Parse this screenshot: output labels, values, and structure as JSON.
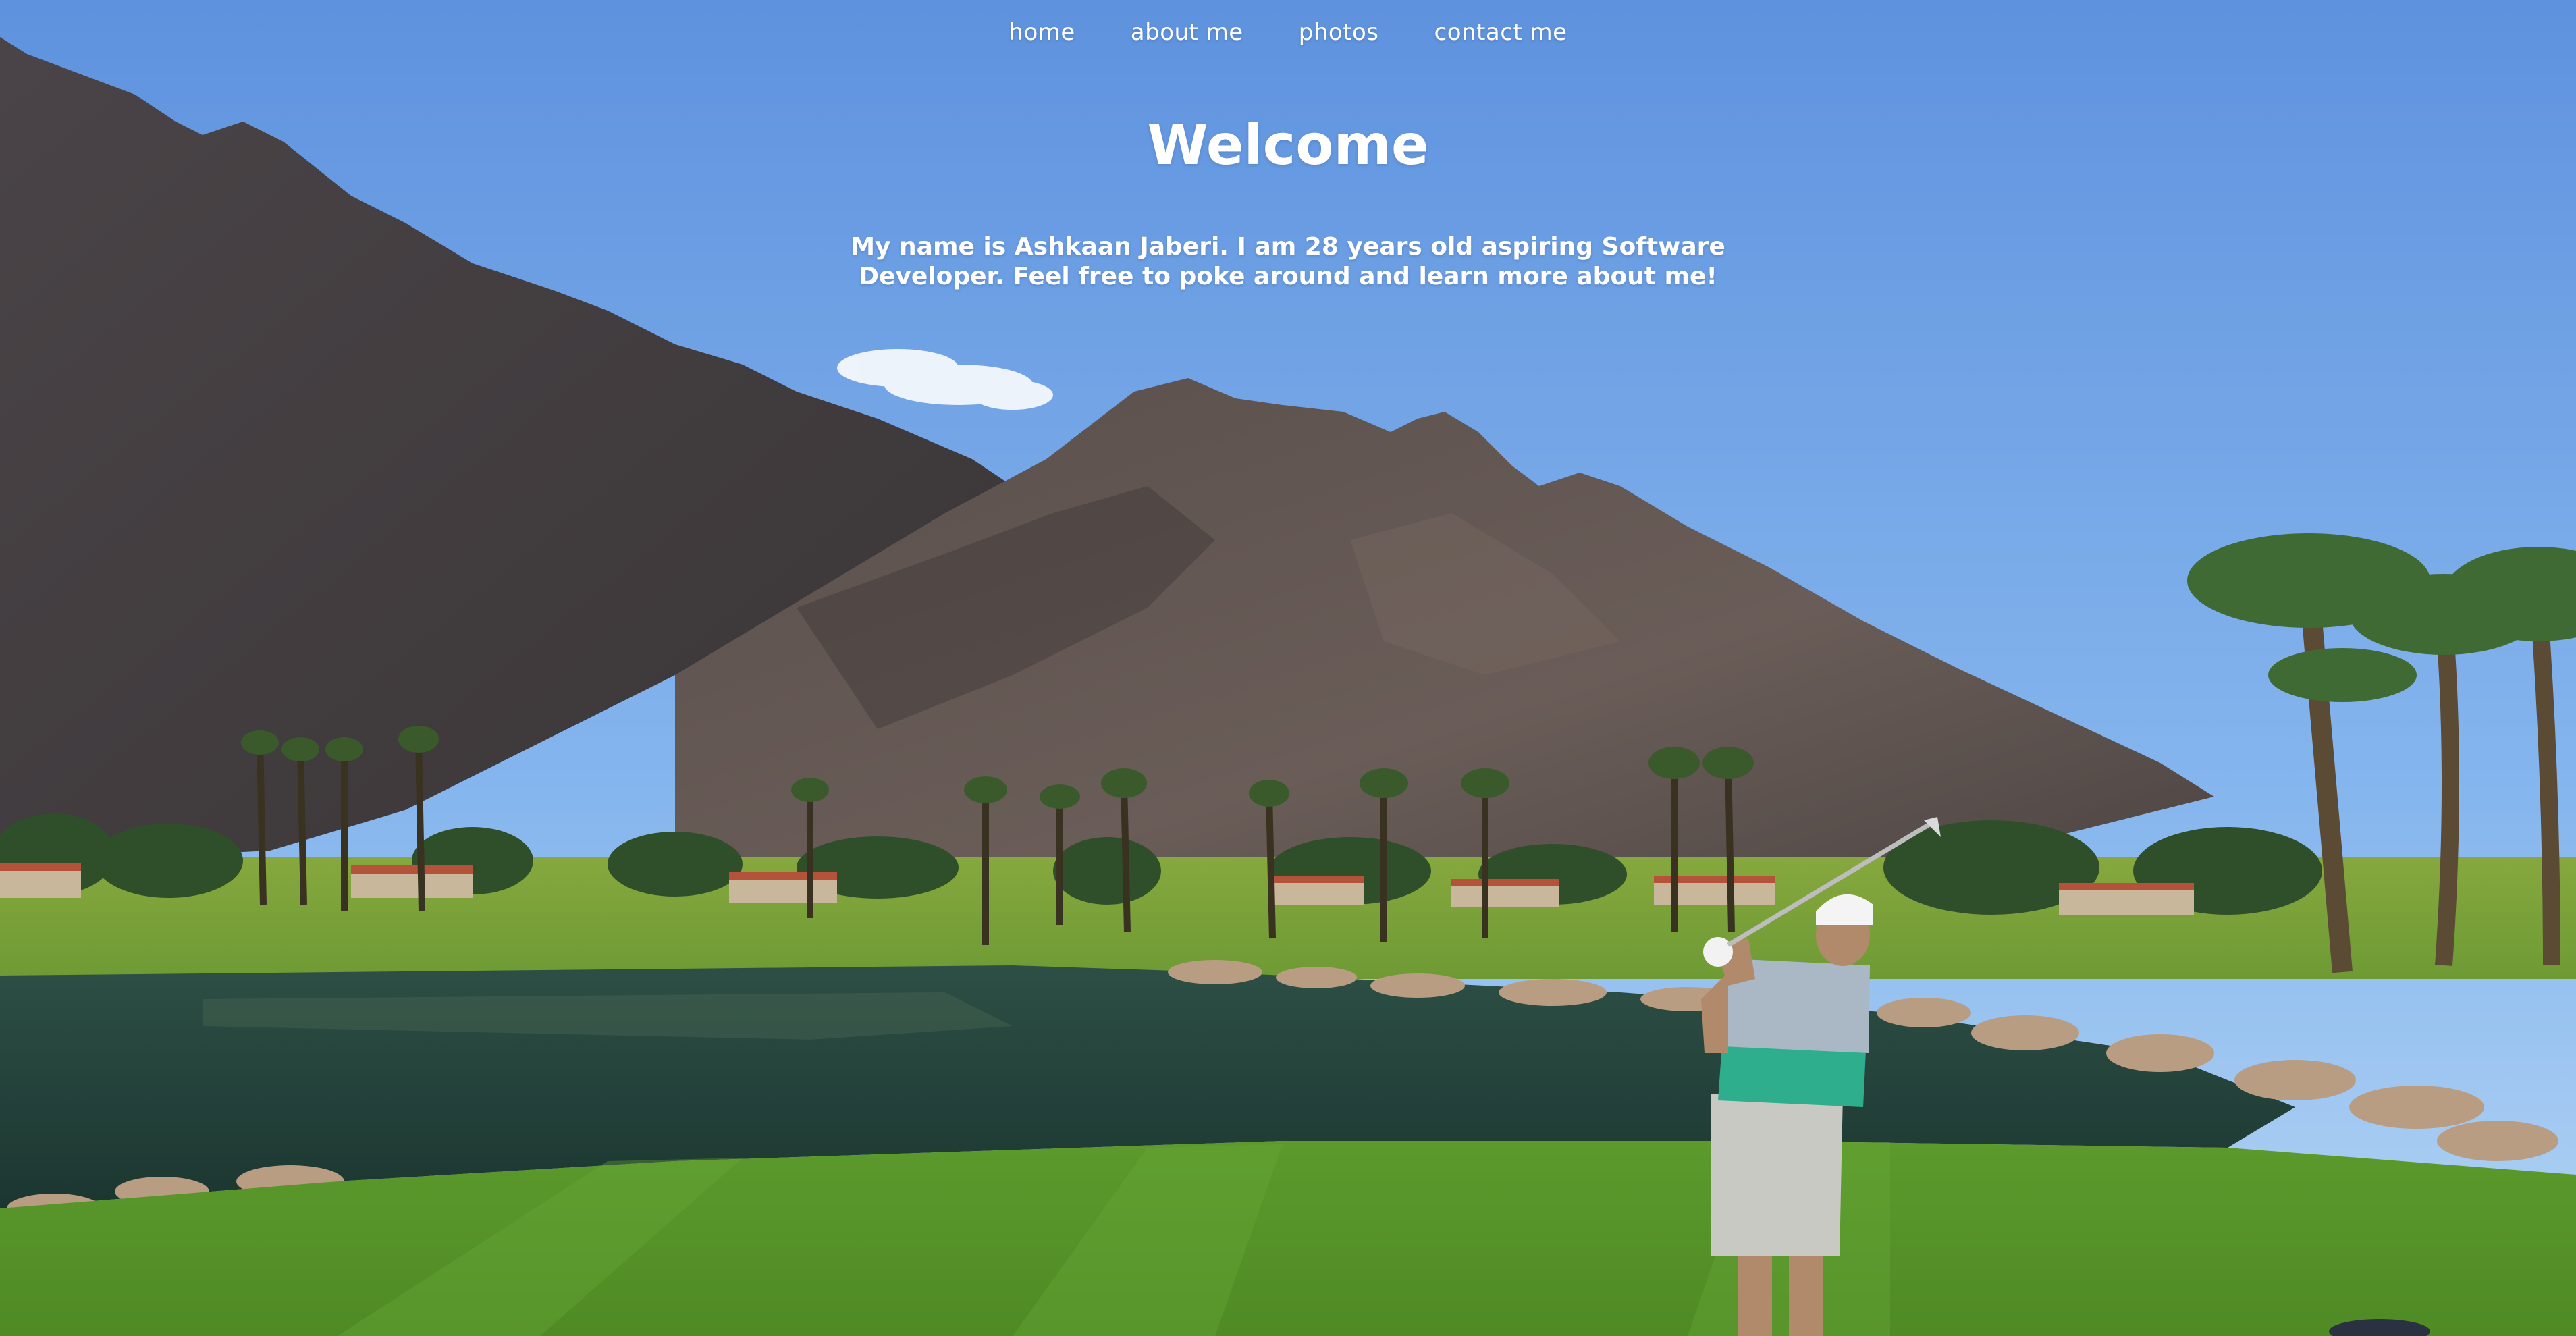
{
  "nav": {
    "items": [
      {
        "label": "home"
      },
      {
        "label": "about me"
      },
      {
        "label": "photos"
      },
      {
        "label": "contact me"
      }
    ]
  },
  "hero": {
    "title": "Welcome",
    "intro": "My name is Ashkaan Jaberi. I am 28 years old aspiring Software Developer. Feel free to poke around and learn more about me!"
  },
  "colors": {
    "sky_top": "#5e92de",
    "sky_bottom": "#a6cdf2",
    "mountain_dark": "#3f3a3d",
    "mountain_mid": "#5b5150",
    "water": "#1f4038",
    "grass": "#5e9a2e",
    "text": "#ffffff"
  }
}
